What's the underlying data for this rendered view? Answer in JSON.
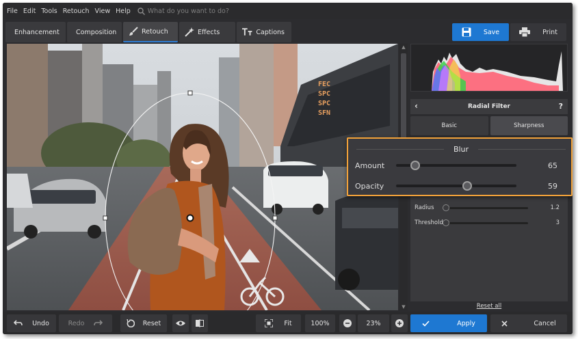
{
  "menu": {
    "items": [
      "File",
      "Edit",
      "Tools",
      "Retouch",
      "View",
      "Help"
    ],
    "search_placeholder": "What do you want to do?"
  },
  "tabs": [
    {
      "label": "Enhancement",
      "icon": "sliders-icon",
      "active": false
    },
    {
      "label": "Composition",
      "icon": "crop-icon",
      "active": false
    },
    {
      "label": "Retouch",
      "icon": "brush-icon",
      "active": true
    },
    {
      "label": "Effects",
      "icon": "magic-wand-icon",
      "active": false
    },
    {
      "label": "Captions",
      "icon": "text-icon",
      "active": false
    }
  ],
  "actions": {
    "save": "Save",
    "print": "Print"
  },
  "photo_overlay": {
    "sign_text": [
      "FEC",
      "SPC",
      "SPC",
      "SFN"
    ]
  },
  "panel": {
    "title": "Radial Filter",
    "help": "?",
    "subtabs": [
      {
        "label": "Basic",
        "active": false
      },
      {
        "label": "Sharpness",
        "active": true
      }
    ],
    "sliders": [
      {
        "label": "Radius",
        "value": "1.2",
        "fraction": 0.0
      },
      {
        "label": "Threshold",
        "value": "3",
        "fraction": 0.0
      }
    ],
    "reset_all": "Reset all"
  },
  "blur_callout": {
    "title": "Blur",
    "sliders": [
      {
        "label": "Amount",
        "value": "65",
        "fraction": 0.16
      },
      {
        "label": "Opacity",
        "value": "59",
        "fraction": 0.59
      }
    ]
  },
  "bottom": {
    "undo": "Undo",
    "redo": "Redo",
    "reset": "Reset",
    "fit": "Fit",
    "zoom_100": "100%",
    "zoom_value": "23%",
    "apply": "Apply",
    "cancel": "Cancel"
  },
  "colors": {
    "accent": "#1e78d2",
    "callout_border": "#f2a23a"
  }
}
